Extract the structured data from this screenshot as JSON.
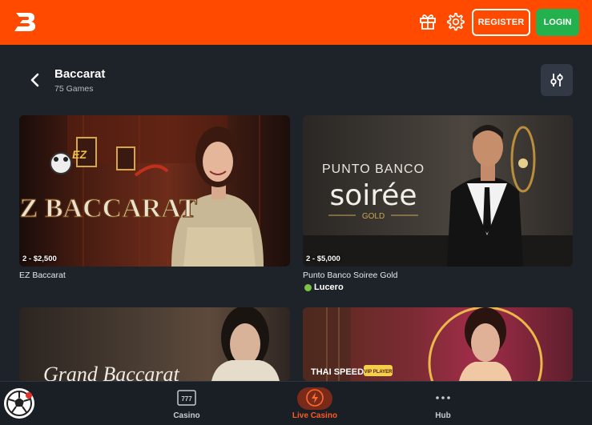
{
  "header": {
    "logo_icon": "brand-b-logo-icon",
    "register_label": "REGISTER",
    "login_label": "LOGIN",
    "accent_color": "#ff4a00",
    "login_color": "#22b14c"
  },
  "page": {
    "title": "Baccarat",
    "subtitle": "75 Games"
  },
  "games": [
    {
      "limit": "2 - $2,500",
      "name": "EZ Baccarat",
      "art": "EZ BACCARAT"
    },
    {
      "limit": "2 - $5,000",
      "name": "Punto Banco Soiree Gold",
      "art_top": "PUNTO BANCO",
      "art_main": "soirée",
      "art_sub": "GOLD",
      "provider": "Lucero"
    },
    {
      "art": "Grand Baccarat"
    },
    {
      "art": "THAI SPEED",
      "badge": "VIP PLAYER"
    }
  ],
  "bottom_nav": {
    "items": [
      {
        "label": "Casino",
        "icon": "slot-777-icon"
      },
      {
        "label": "Live Casino",
        "icon": "lightning-icon"
      },
      {
        "label": "Hub",
        "icon": "more-dots-icon"
      }
    ],
    "active_color": "#ff5a1f"
  }
}
